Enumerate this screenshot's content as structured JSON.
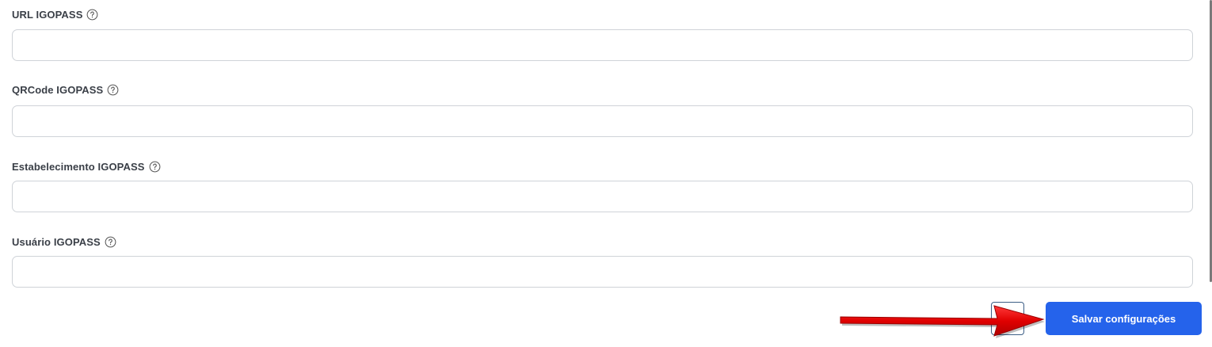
{
  "fields": [
    {
      "label": "URL IGOPASS",
      "value": "",
      "help_icon": "question-circle-icon"
    },
    {
      "label": "QRCode IGOPASS",
      "value": "",
      "help_icon": "question-circle-icon"
    },
    {
      "label": "Estabelecimento IGOPASS",
      "value": "",
      "help_icon": "question-circle-icon"
    },
    {
      "label": "Usuário IGOPASS",
      "value": "",
      "help_icon": "question-circle-icon"
    }
  ],
  "actions": {
    "save_label": "Salvar configurações"
  },
  "colors": {
    "primary": "#2563eb",
    "annotation_arrow": "#e00000",
    "label_text": "#3a3f47",
    "input_border": "#cfd3d8"
  },
  "annotation": {
    "icon": "red-arrow-icon"
  }
}
